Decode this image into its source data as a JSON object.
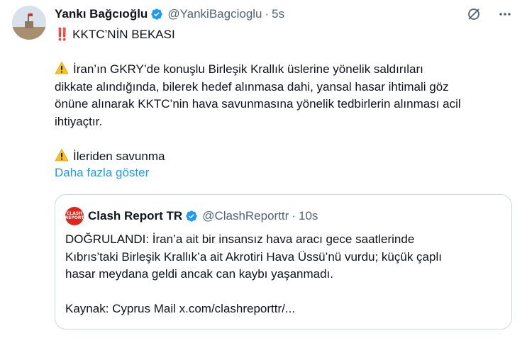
{
  "author": {
    "name": "Yankı Bağcıoğlu",
    "handle": "@YankiBagcioglu",
    "separator": "·",
    "time": "5s"
  },
  "tweet": {
    "title_emoji": "‼️",
    "title": "KKTC’NİN BEKASI",
    "body_lines": [
      "İran’ın GKRY’de konuşlu Birleşik Krallık üslerine yönelik saldırıları",
      "dikkate alındığında, bilerek hedef alınmasa dahi, yansal hasar ihtimali göz",
      "önüne alınarak KKTC’nin hava savunmasına yönelik tedbirlerin alınması acil",
      "ihtiyaçtır."
    ],
    "closing": "İleriden savunma",
    "show_more": "Daha fazla göster"
  },
  "quote": {
    "name": "Clash Report TR",
    "handle": "@ClashReporttr",
    "separator": "·",
    "time": "10s",
    "logo_text": "CLASH REPORT",
    "lines": [
      "DOĞRULANDI: İran’a ait bir insansız hava aracı gece saatlerinde",
      "Kıbrıs’taki Birleşik Krallık’a ait Akrotiri Hava Üssü’nü vurdu; küçük çaplı",
      "hasar meydana geldi ancak can kaybı yaşanmadı.",
      "",
      "Kaynak: Cyprus Mail x.com/clashreporttr/..."
    ]
  },
  "colors": {
    "verified": "#1d9bf0",
    "link": "#1d9bf0",
    "muted": "#536471",
    "warning": "#f7c21f",
    "logo": "#e1251b"
  },
  "icons": [
    "grok-icon",
    "more-icon",
    "warning-icon",
    "verified-badge-icon"
  ]
}
